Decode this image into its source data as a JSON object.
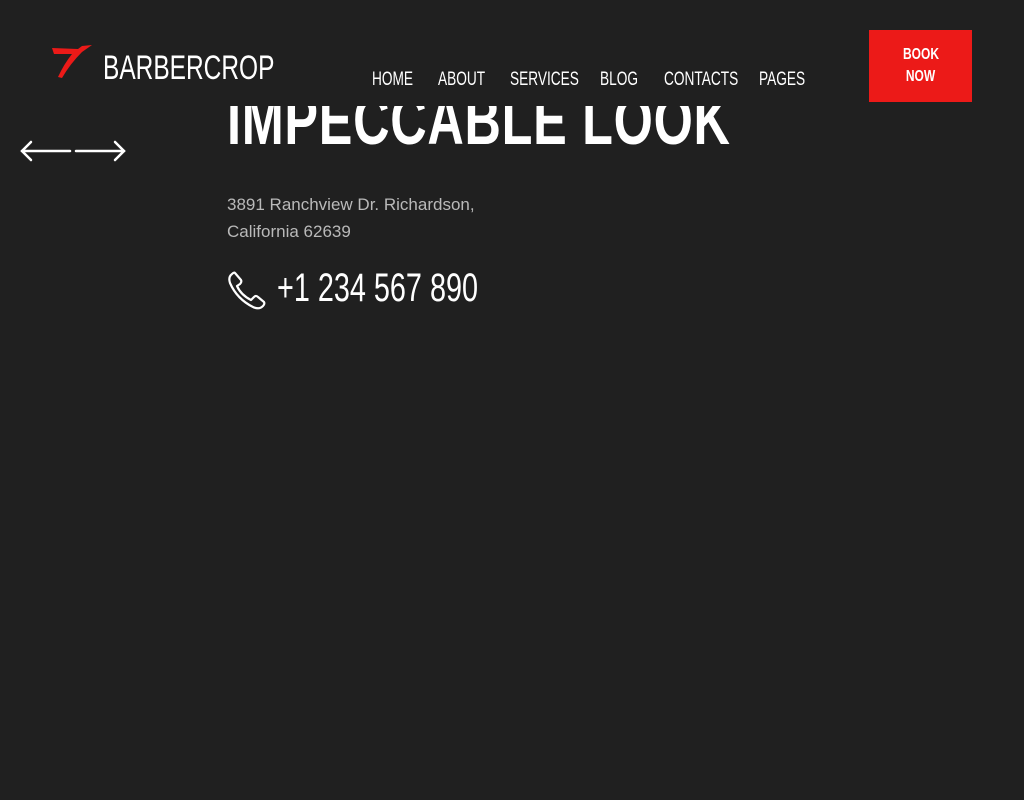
{
  "brand": {
    "name": "BARBERCROP",
    "accent": "#ec1a18",
    "logo_icon": "razor-icon"
  },
  "nav": {
    "items": [
      {
        "label": "HOME"
      },
      {
        "label": "ABOUT"
      },
      {
        "label": "SERVICES"
      },
      {
        "label": "BLOG"
      },
      {
        "label": "CONTACTS"
      },
      {
        "label": "PAGES"
      }
    ]
  },
  "cta": {
    "line1": "BOOK",
    "line2": "NOW"
  },
  "hero": {
    "title": "IMPECCABLE LOOK",
    "prev_icon": "arrow-left-icon",
    "next_icon": "arrow-right-icon"
  },
  "contact": {
    "address_line1": "3891 Ranchview Dr. Richardson,",
    "address_line2": "California 62639",
    "phone": "+1 234 567 890",
    "phone_icon": "phone-icon"
  }
}
